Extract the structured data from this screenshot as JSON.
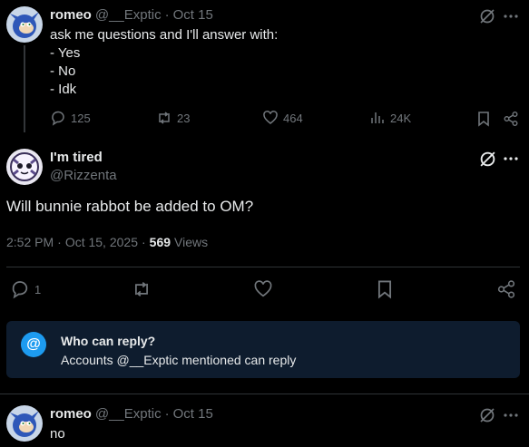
{
  "colors": {
    "background": "#000000",
    "text": "#e7e9ea",
    "muted": "#71767b",
    "accent": "#1d9bf0",
    "notice_bg": "#0e1c2e",
    "divider": "#2f3336"
  },
  "parent_post": {
    "name": "romeo",
    "handle": "@__Exptic",
    "sep": "·",
    "date": "Oct 15",
    "lines": [
      "ask me questions and I'll answer with:",
      "- Yes",
      "- No",
      "- Idk"
    ],
    "replies": "125",
    "reposts": "23",
    "likes": "464",
    "views": "24K"
  },
  "main_post": {
    "name": "I'm tired",
    "handle": "@Rizzenta",
    "text": "Will bunnie rabbot be added to OM?",
    "time": "2:52 PM",
    "sep1": "·",
    "date": "Oct 15, 2025",
    "sep2": "·",
    "views_count": "569",
    "views_label": "Views",
    "replies": "1"
  },
  "reply_notice": {
    "icon": "@",
    "title": "Who can reply?",
    "subtitle": "Accounts @__Exptic mentioned can reply"
  },
  "reply_post": {
    "name": "romeo",
    "handle": "@__Exptic",
    "sep": "·",
    "date": "Oct 15",
    "text": "no"
  }
}
